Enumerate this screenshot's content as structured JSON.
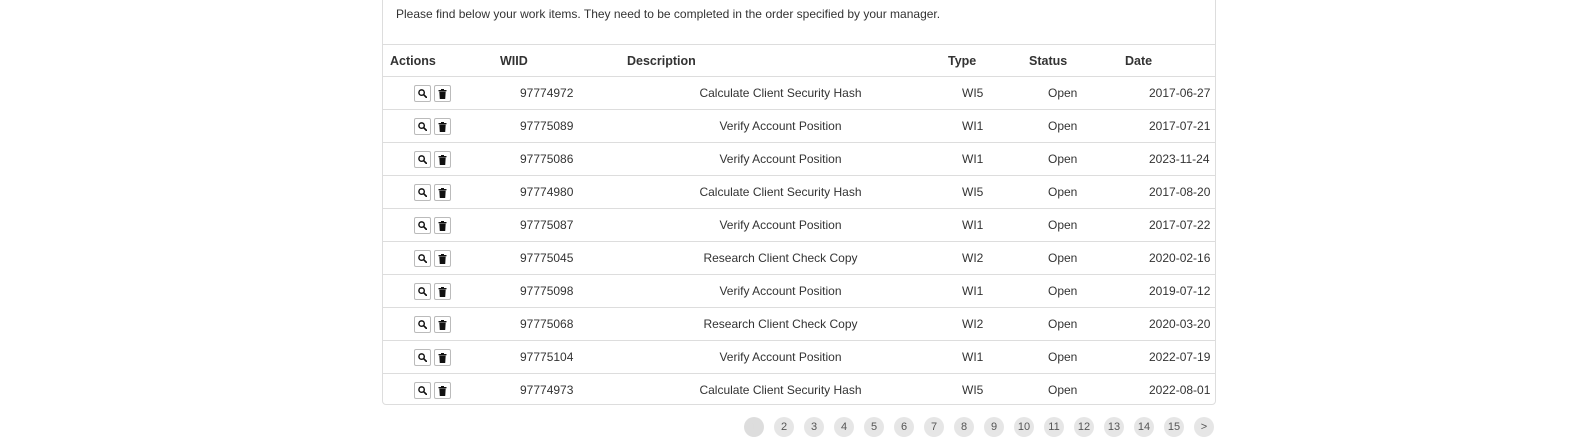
{
  "intro_text": "Please find below your work items. They need to be completed in the order specified by your manager.",
  "table": {
    "headers": {
      "actions": "Actions",
      "wiid": "WIID",
      "description": "Description",
      "type": "Type",
      "status": "Status",
      "date": "Date"
    },
    "action_icons": [
      "search-icon",
      "trash-icon"
    ],
    "rows": [
      {
        "wiid": "97774972",
        "description": "Calculate Client Security Hash",
        "type": "WI5",
        "status": "Open",
        "date": "2017-06-27"
      },
      {
        "wiid": "97775089",
        "description": "Verify Account Position",
        "type": "WI1",
        "status": "Open",
        "date": "2017-07-21"
      },
      {
        "wiid": "97775086",
        "description": "Verify Account Position",
        "type": "WI1",
        "status": "Open",
        "date": "2023-11-24"
      },
      {
        "wiid": "97774980",
        "description": "Calculate Client Security Hash",
        "type": "WI5",
        "status": "Open",
        "date": "2017-08-20"
      },
      {
        "wiid": "97775087",
        "description": "Verify Account Position",
        "type": "WI1",
        "status": "Open",
        "date": "2017-07-22"
      },
      {
        "wiid": "97775045",
        "description": "Research Client Check Copy",
        "type": "WI2",
        "status": "Open",
        "date": "2020-02-16"
      },
      {
        "wiid": "97775098",
        "description": "Verify Account Position",
        "type": "WI1",
        "status": "Open",
        "date": "2019-07-12"
      },
      {
        "wiid": "97775068",
        "description": "Research Client Check Copy",
        "type": "WI2",
        "status": "Open",
        "date": "2020-03-20"
      },
      {
        "wiid": "97775104",
        "description": "Verify Account Position",
        "type": "WI1",
        "status": "Open",
        "date": "2022-07-19"
      },
      {
        "wiid": "97774973",
        "description": "Calculate Client Security Hash",
        "type": "WI5",
        "status": "Open",
        "date": "2022-08-01"
      }
    ]
  },
  "pagination": {
    "pages": [
      "1",
      "2",
      "3",
      "4",
      "5",
      "6",
      "7",
      "8",
      "9",
      "10",
      "11",
      "12",
      "13",
      "14",
      "15",
      ">"
    ],
    "current": "1"
  }
}
